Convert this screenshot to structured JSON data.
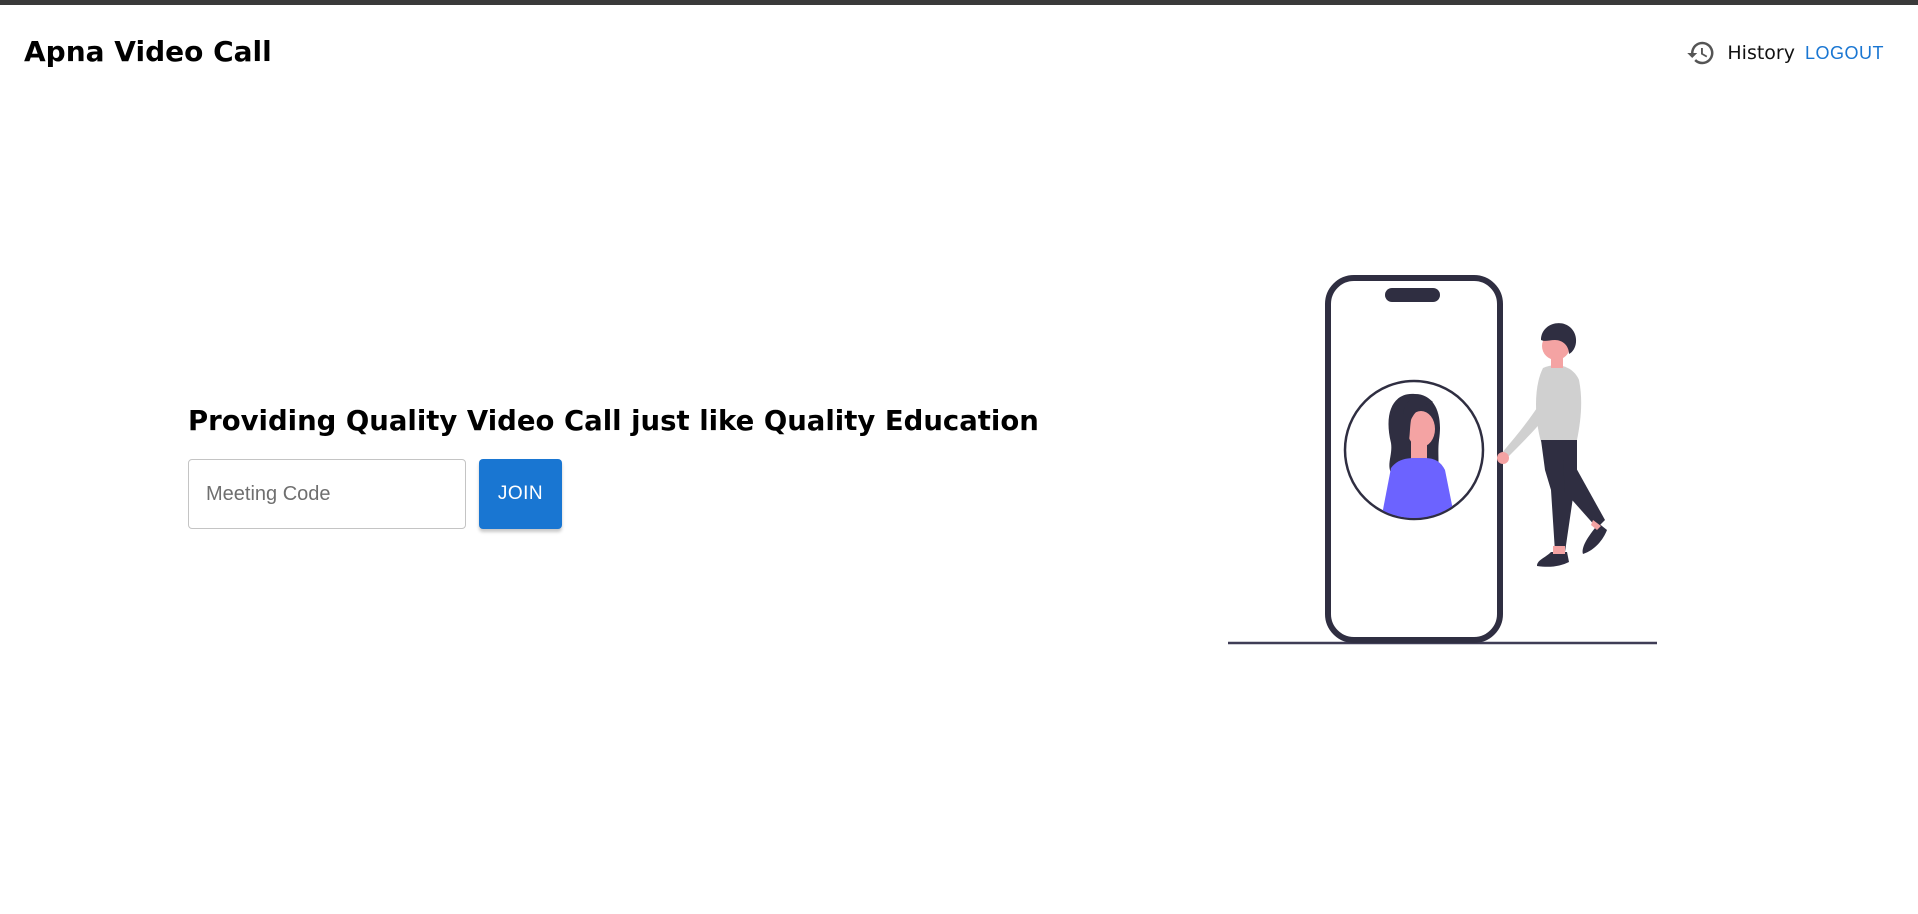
{
  "app": {
    "title": "Apna Video Call"
  },
  "nav": {
    "history_icon": "history-icon",
    "history_label": "History",
    "logout_label": "LOGOUT"
  },
  "main": {
    "tagline": "Providing Quality Video Call just like Quality Education",
    "meeting_code": {
      "value": "",
      "placeholder": "Meeting Code"
    },
    "join_label": "JOIN"
  },
  "colors": {
    "accent": "#1976d2",
    "illustration_dark": "#2f2e41",
    "illustration_purple": "#6c63ff",
    "skin": "#f4a3a3"
  }
}
